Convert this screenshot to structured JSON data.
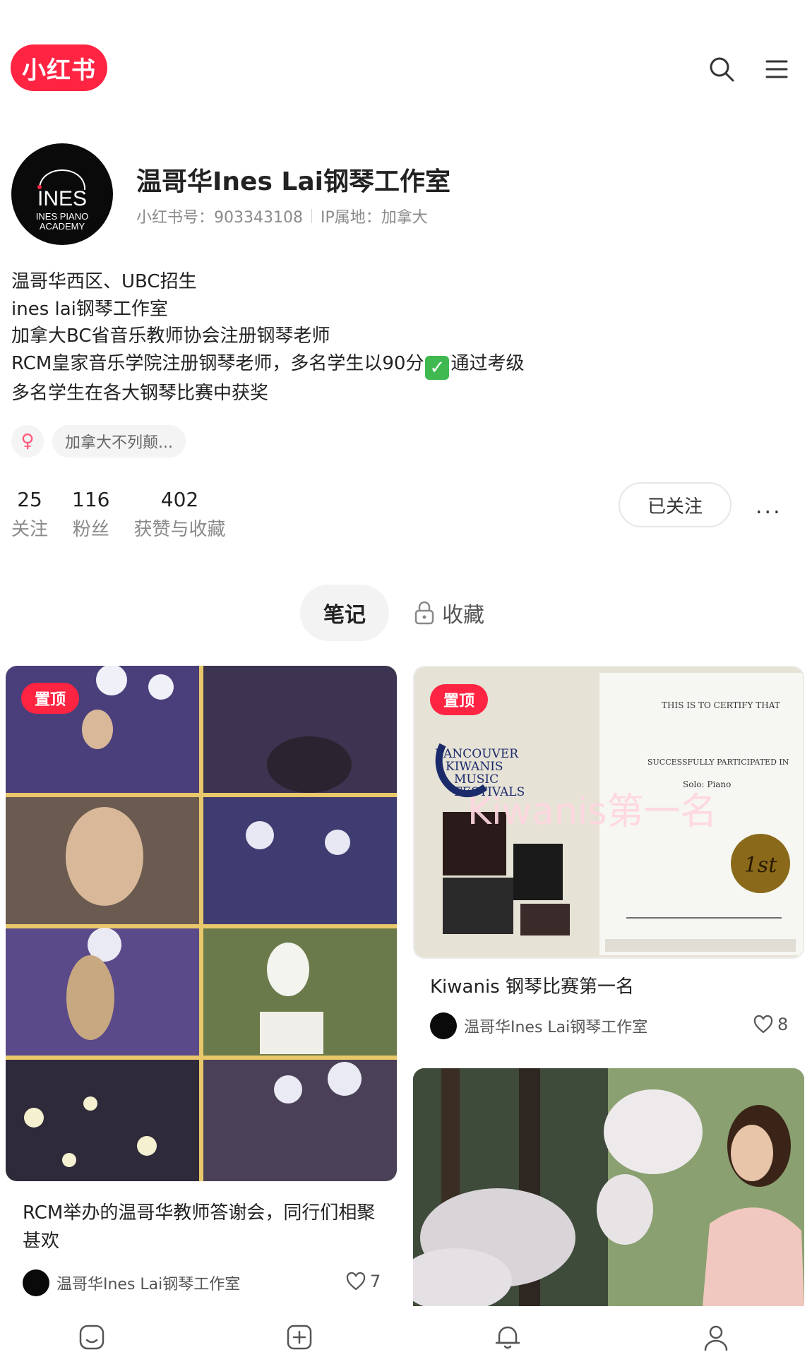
{
  "header": {
    "logo_text": "小红书",
    "search_icon": "search-icon",
    "menu_icon": "menu-icon"
  },
  "profile": {
    "avatar_text_main": "INES",
    "avatar_text_sub1": "INES PIANO",
    "avatar_text_sub2": "ACADEMY",
    "name": "温哥华Ines Lai钢琴工作室",
    "red_id": "小红书号：903343108",
    "ip_location": "IP属地：加拿大",
    "bio_lines": [
      "温哥华西区、UBC招生",
      "ines lai钢琴工作室",
      "加拿大BC省音乐教师协会注册钢琴老师",
      "RCM皇家音乐学院注册钢琴老师，多名学生以90分",
      "通过考级",
      "多名学生在各大钢琴比赛中获奖"
    ],
    "check_emoji": "✓",
    "gender_symbol": "♀",
    "location_tag": "加拿大不列颠...",
    "stats": [
      {
        "value": "25",
        "label": "关注"
      },
      {
        "value": "116",
        "label": "粉丝"
      },
      {
        "value": "402",
        "label": "获赞与收藏"
      }
    ],
    "follow_label": "已关注",
    "more_label": "..."
  },
  "tabs": {
    "notes": "笔记",
    "collections": "收藏"
  },
  "notes": [
    {
      "pin_label": "置顶",
      "title": "RCM举办的温哥华教师答谢会，同行们相聚甚欢",
      "author": "温哥华Ines Lai钢琴工作室",
      "likes": "7"
    },
    {
      "pin_label": "置顶",
      "image_text_1": "VANCOUVER",
      "image_text_2": "KIWANIS",
      "image_text_3": "MUSIC",
      "image_text_4": "FESTIVALS",
      "image_overlay": "Kiwanis第一名",
      "cert_line_1": "THIS IS TO CERTIFY THAT",
      "cert_line_2": "SUCCESSFULLY PARTICIPATED IN",
      "cert_line_3": "Solo: Piano",
      "cert_seal": "1st",
      "title": "Kiwanis 钢琴比赛第一名",
      "author": "温哥华Ines Lai钢琴工作室",
      "likes": "8"
    }
  ],
  "colors": {
    "brand_red": "#ff2442",
    "muted_text": "#8a8a8a",
    "chip_bg": "#f4f4f4"
  },
  "bottom_nav": [
    "home-icon",
    "publish-icon",
    "notification-icon",
    "profile-icon"
  ]
}
